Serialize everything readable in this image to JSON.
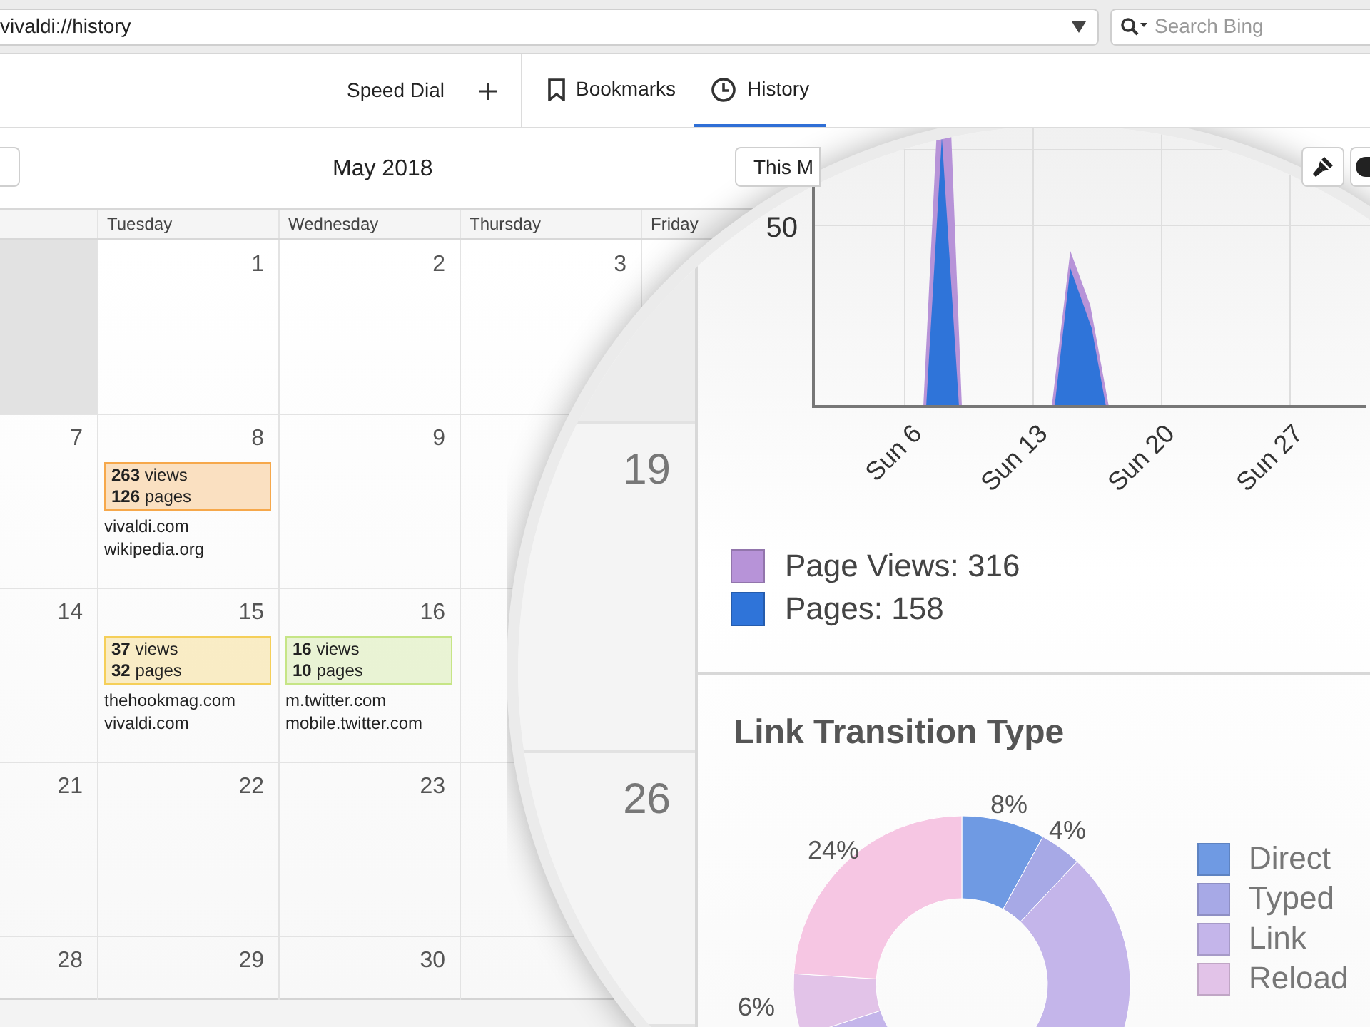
{
  "address_bar": {
    "url": "vivaldi://history"
  },
  "search": {
    "placeholder": "Search Bing"
  },
  "speed_dial": {
    "label": "Speed Dial"
  },
  "panel_tabs": [
    {
      "label": "Bookmarks",
      "kind": "bookmark",
      "selected": false
    },
    {
      "label": "History",
      "kind": "clock",
      "selected": true
    }
  ],
  "calendar": {
    "title": "May 2018",
    "range_button": "This M",
    "weekdays": [
      "Tuesday",
      "Wednesday",
      "Thursday",
      "Friday"
    ],
    "weeks": [
      {
        "cells": [
          {
            "outside_month": true
          },
          {
            "day": "1",
            "outside_month": false
          },
          {
            "day": "2",
            "outside_month": false
          },
          {
            "day": "3",
            "outside_month": false
          }
        ]
      },
      {
        "cells": [
          {
            "day": "7",
            "outside_month": false
          },
          {
            "day": "8",
            "outside_month": false,
            "event": {
              "views": "**263** views",
              "pages": "**126** pages",
              "color": "#f6a84b",
              "sites": [
                "vivaldi.com",
                "wikipedia.org"
              ]
            }
          },
          {
            "day": "9",
            "outside_month": false
          }
        ]
      },
      {
        "cells": [
          {
            "day": "14",
            "outside_month": false
          },
          {
            "day": "15",
            "outside_month": false,
            "event": {
              "views": "**37** views",
              "pages": "**32** pages",
              "color": "#f5cf59",
              "sites": [
                "thehookmag.com",
                "vivaldi.com"
              ]
            }
          },
          {
            "day": "16",
            "outside_month": false,
            "event": {
              "views": "**16** views",
              "pages": "**10** pages",
              "color": "#c6e586",
              "sites": [
                "m.twitter.com",
                "mobile.twitter.com"
              ]
            }
          }
        ]
      },
      {
        "cells": [
          {
            "day": "21",
            "outside_month": false
          },
          {
            "day": "22",
            "outside_month": false
          },
          {
            "day": "23",
            "outside_month": false
          }
        ]
      },
      {
        "cells": [
          {
            "day": "28",
            "outside_month": false
          },
          {
            "day": "29",
            "outside_month": false
          },
          {
            "day": "30",
            "outside_month": false
          }
        ]
      }
    ]
  },
  "magnifier": {
    "days": [
      "19",
      "26"
    ],
    "traffic_chart": {
      "y_tick": "50",
      "x_labels": [
        "Sun 6",
        "Sun 13",
        "Sun 20",
        "Sun 27"
      ],
      "legend": [
        {
          "label": "Page Views: 316",
          "color": "#b793d8"
        },
        {
          "label": "Pages: 158",
          "color": "#2f74d9"
        }
      ]
    },
    "transitions": {
      "title": "Link Transition Type",
      "percent_labels": [
        "8%",
        "4%",
        "24%",
        "6%"
      ],
      "legend": [
        {
          "label": "Direct",
          "color": "#6f9ae3"
        },
        {
          "label": "Typed",
          "color": "#a7a9e6"
        },
        {
          "label": "Link",
          "color": "#c4b5ea"
        },
        {
          "label": "Reload",
          "color": "#e2c3e8"
        }
      ]
    }
  }
}
